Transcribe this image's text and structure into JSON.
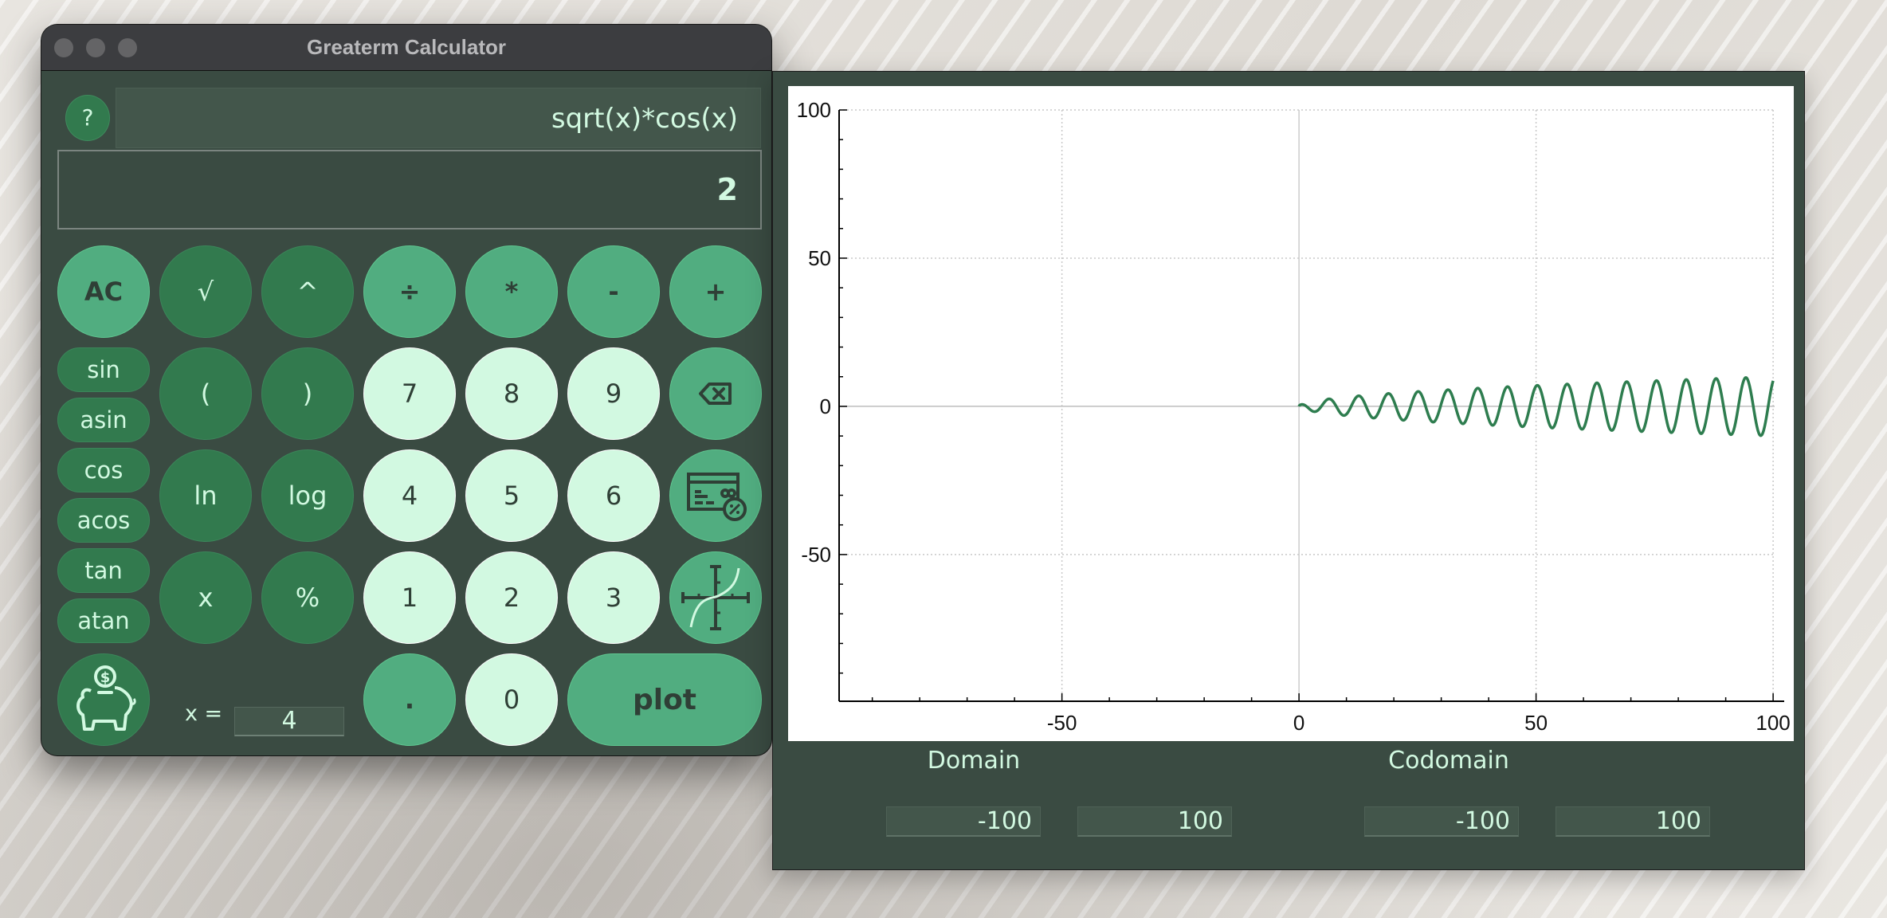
{
  "calculator": {
    "window_title": "Greaterm Calculator",
    "help_label": "?",
    "expression": "sqrt(x)*cos(x)",
    "result": "2",
    "rows": [
      [
        {
          "label": "AC",
          "style": "op",
          "name": "clear-button"
        },
        {
          "label": "√",
          "style": "fn",
          "name": "sqrt-button"
        },
        {
          "label": "^",
          "style": "fn",
          "name": "power-button"
        },
        {
          "label": "÷",
          "style": "op",
          "name": "divide-button"
        },
        {
          "label": "*",
          "style": "op",
          "name": "multiply-button"
        },
        {
          "label": "-",
          "style": "op",
          "name": "subtract-button"
        },
        {
          "label": "+",
          "style": "op",
          "name": "add-button"
        }
      ],
      [
        {
          "label": "(",
          "style": "fn",
          "name": "open-paren-button"
        },
        {
          "label": ")",
          "style": "fn",
          "name": "close-paren-button"
        },
        {
          "label": "7",
          "style": "num",
          "name": "digit-7-button"
        },
        {
          "label": "8",
          "style": "num",
          "name": "digit-8-button"
        },
        {
          "label": "9",
          "style": "num",
          "name": "digit-9-button"
        }
      ],
      [
        {
          "label": "ln",
          "style": "fn",
          "name": "ln-button"
        },
        {
          "label": "log",
          "style": "fn",
          "name": "log-button"
        },
        {
          "label": "4",
          "style": "num",
          "name": "digit-4-button"
        },
        {
          "label": "5",
          "style": "num",
          "name": "digit-5-button"
        },
        {
          "label": "6",
          "style": "num",
          "name": "digit-6-button"
        }
      ],
      [
        {
          "label": "x",
          "style": "fn",
          "name": "variable-x-button"
        },
        {
          "label": "%",
          "style": "fn",
          "name": "percent-button"
        },
        {
          "label": "1",
          "style": "num",
          "name": "digit-1-button"
        },
        {
          "label": "2",
          "style": "num",
          "name": "digit-2-button"
        },
        {
          "label": "3",
          "style": "num",
          "name": "digit-3-button"
        }
      ]
    ],
    "trig_buttons": [
      "sin",
      "asin",
      "cos",
      "acos",
      "tan",
      "atan"
    ],
    "icon_buttons": {
      "backspace": "backspace-icon",
      "finance": "credit-card-percent-icon",
      "graph": "function-graph-icon",
      "savings": "piggy-bank-icon"
    },
    "x_label": "x =",
    "x_value": "4",
    "dot_label": ".",
    "zero_label": "0",
    "plot_label": "plot"
  },
  "plot_panel": {
    "domain_title": "Domain",
    "codomain_title": "Codomain",
    "domain_min": "-100",
    "domain_max": "100",
    "codomain_min": "-100",
    "codomain_max": "100"
  },
  "colors": {
    "window_bg": "#3a4b42",
    "operator": "#51ad80",
    "function": "#327a4e",
    "digit": "#d2f9e1",
    "text_light": "#d2f9e1",
    "curve": "#2e7d4f"
  },
  "chart_data": {
    "type": "line",
    "title": "",
    "function": "sqrt(x)*cos(x)",
    "xlabel": "",
    "ylabel": "",
    "xlim": [
      -97,
      102
    ],
    "ylim": [
      -99.5,
      100
    ],
    "x_ticks": [
      -50,
      0,
      50,
      100
    ],
    "x_tick_labels": [
      "-50",
      "0",
      "50",
      "100"
    ],
    "y_ticks": [
      100,
      50,
      0,
      -50
    ],
    "y_tick_labels": [
      "100",
      "50",
      "0",
      "-50"
    ],
    "grid": true,
    "series": [
      {
        "name": "sqrt(x)*cos(x)",
        "x_range": [
          0,
          100
        ],
        "color": "#2e7d4f"
      }
    ]
  }
}
